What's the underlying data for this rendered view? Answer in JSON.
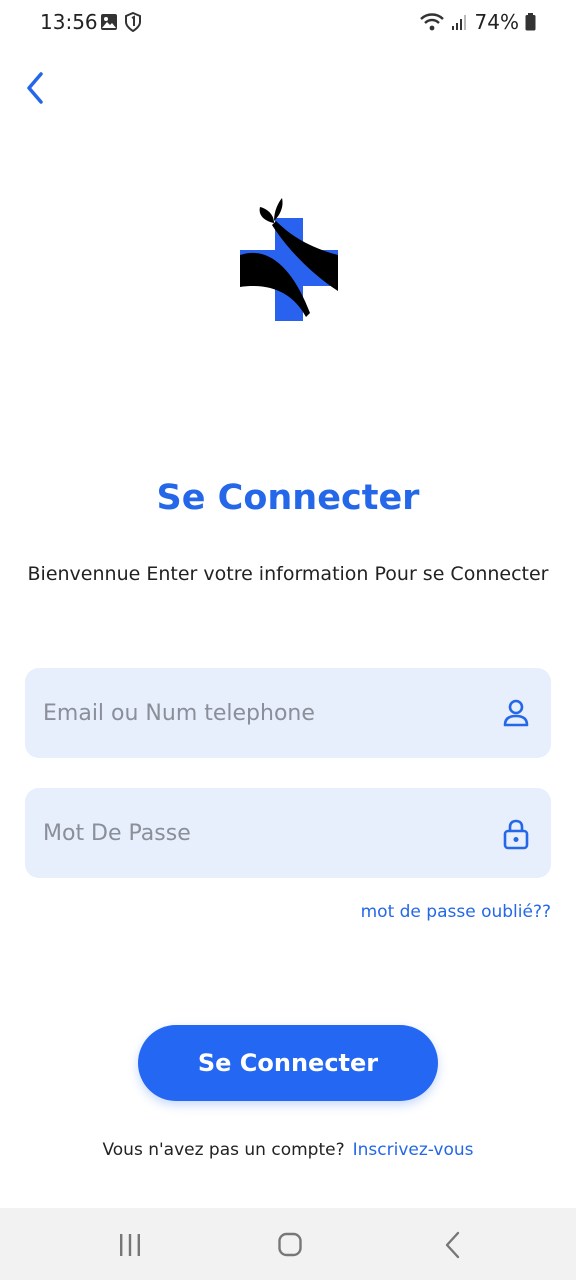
{
  "status_bar": {
    "time": "13:56",
    "battery": "74%",
    "icons": [
      "image-icon",
      "shield-one-icon",
      "wifi-icon",
      "signal-icon",
      "battery-icon"
    ]
  },
  "back": {
    "icon": "chevron-left-icon"
  },
  "logo": {
    "icon": "medical-cross-leaf-logo"
  },
  "title": "Se Connecter",
  "subtitle": "Bienvennue Enter votre information Pour se Connecter",
  "form": {
    "email_placeholder": "Email ou Num telephone",
    "password_placeholder": "Mot De Passe",
    "email_icon": "user-icon",
    "password_icon": "lock-icon",
    "forgot_password": "mot de passe oublié??",
    "submit_label": "Se Connecter"
  },
  "signup": {
    "prompt": "Vous n'avez pas un compte?",
    "link": "Inscrivez-vous"
  },
  "nav": {
    "icons": [
      "recents-icon",
      "home-icon",
      "back-nav-icon"
    ]
  },
  "colors": {
    "accent": "#2467e8",
    "button": "#2467f2",
    "field_bg": "#e7eefc",
    "nav_bg": "#f2f2f2"
  }
}
